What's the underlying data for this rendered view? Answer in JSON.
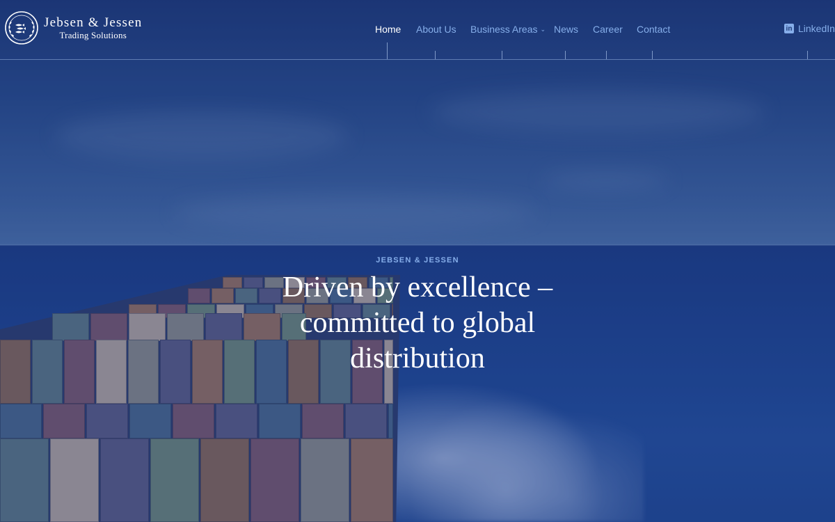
{
  "brand": {
    "name": "Jebsen & Jessen",
    "tagline": "Trading Solutions"
  },
  "nav": {
    "items": [
      {
        "label": "Home",
        "active": true
      },
      {
        "label": "About Us"
      },
      {
        "label": "Business Areas",
        "has_dropdown": true
      },
      {
        "label": "News"
      },
      {
        "label": "Career"
      },
      {
        "label": "Contact"
      }
    ],
    "linkedin": {
      "label": "LinkedIn",
      "icon": "linkedin-icon"
    }
  },
  "hero": {
    "eyebrow": "JEBSEN & JESSEN",
    "headline": "Driven by excellence – committed to global distribution",
    "background": "container-ship-at-sea"
  },
  "colors": {
    "overlay": "#1e3a78",
    "nav_text": "#86aeea",
    "nav_active": "#ffffff",
    "headline": "#ffffff"
  }
}
